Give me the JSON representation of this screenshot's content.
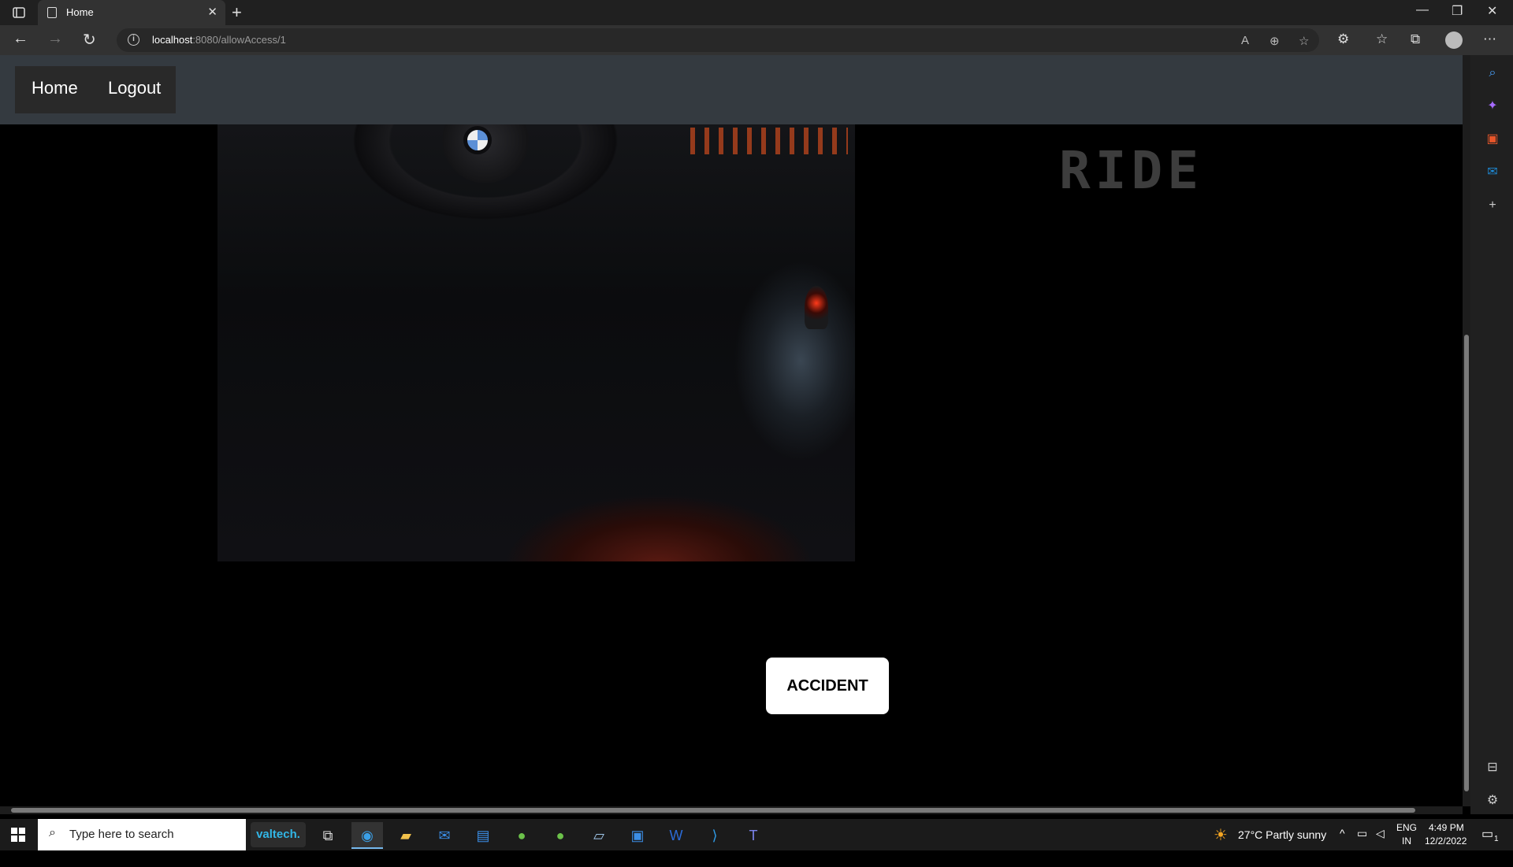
{
  "browser": {
    "tab_title": "Home",
    "url_host": "localhost",
    "url_rest": ":8080/allowAccess/1"
  },
  "site": {
    "nav": {
      "home_label": "Home",
      "logout_label": "Logout"
    },
    "heading": "RIDE",
    "accident_button": "ACCIDENT"
  },
  "taskbar": {
    "search_placeholder": "Type here to search",
    "valtech_label": "valtech.",
    "weather": "27°C  Partly sunny",
    "lang_top": "ENG",
    "lang_bottom": "IN",
    "time": "4:49 PM",
    "date": "12/2/2022",
    "notif_count": "1"
  },
  "colors": {
    "nav_bg": "#343a40",
    "page_bg": "#000000",
    "heading": "#3d3d3d",
    "button_bg": "#ffffff"
  }
}
